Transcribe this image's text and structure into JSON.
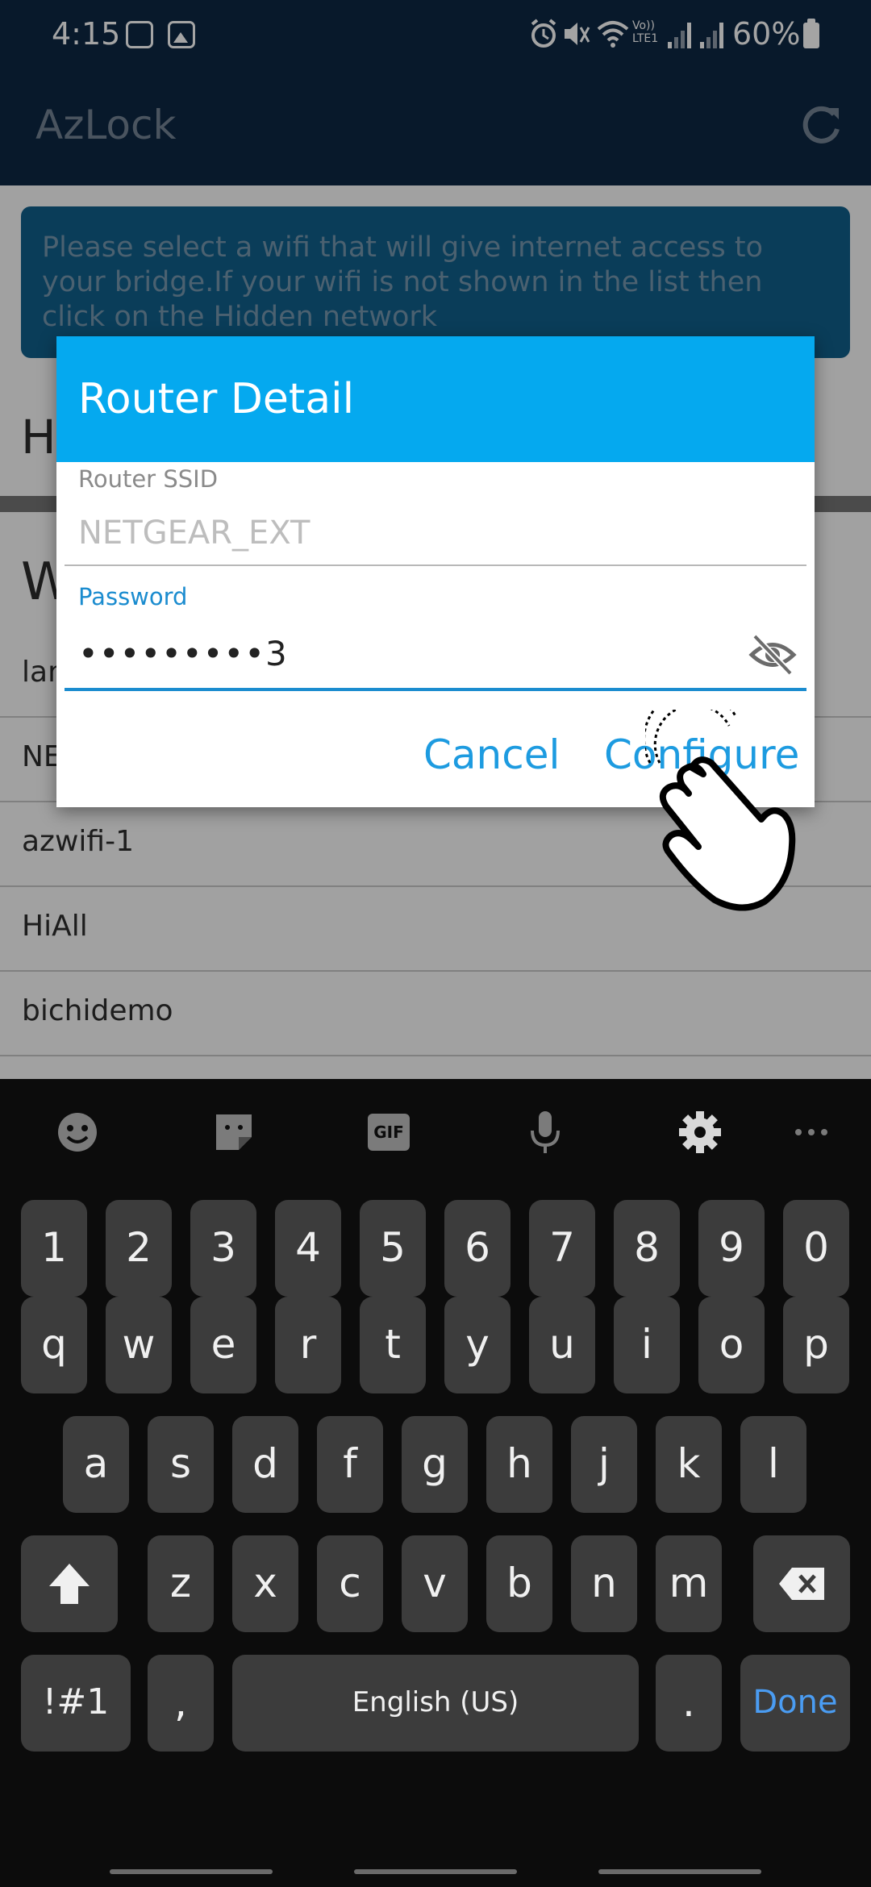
{
  "status_bar": {
    "time": "4:15",
    "battery": "60%",
    "icons": [
      "app-notification-icon",
      "gallery-icon",
      "alarm-icon",
      "mute-icon",
      "wifi-icon",
      "volte-icon",
      "signal-icon",
      "signal-icon",
      "battery-icon"
    ],
    "volte_label": "Vo)) LTE1"
  },
  "app_bar": {
    "title": "AzLock",
    "action_icon": "refresh-icon"
  },
  "background": {
    "banner_text": "Please select a wifi that will give internet access to your bridge.If your wifi is not shown in the list then click on the Hidden network",
    "section_h_letter": "H",
    "section_w_letter": "W",
    "wifi_list": [
      "lan",
      "NE",
      "azwifi-1",
      "HiAll",
      "bichidemo"
    ]
  },
  "dialog": {
    "title": "Router Detail",
    "ssid_label": "Router SSID",
    "ssid_value": "NETGEAR_EXT",
    "password_label": "Password",
    "password_value": "•••••••••3",
    "visibility_icon": "visibility-off-icon",
    "cancel_label": "Cancel",
    "configure_label": "Configure"
  },
  "keyboard": {
    "toolbar": [
      "emoji-icon",
      "sticker-icon",
      "gif-icon",
      "microphone-icon",
      "settings-icon",
      "more-icon"
    ],
    "gif_label": "GIF",
    "row_numbers": [
      "1",
      "2",
      "3",
      "4",
      "5",
      "6",
      "7",
      "8",
      "9",
      "0"
    ],
    "row_q": [
      "q",
      "w",
      "e",
      "r",
      "t",
      "y",
      "u",
      "i",
      "o",
      "p"
    ],
    "row_a": [
      "a",
      "s",
      "d",
      "f",
      "g",
      "h",
      "j",
      "k",
      "l"
    ],
    "row_z": [
      "z",
      "x",
      "c",
      "v",
      "b",
      "n",
      "m"
    ],
    "symbols_label": "!#1",
    "comma_label": ",",
    "space_label": "English (US)",
    "period_label": ".",
    "done_label": "Done"
  },
  "colors": {
    "app_bar": "#0c2540",
    "dialog_header": "#05a9ef",
    "accent": "#1d9be0",
    "keyboard_bg": "#0c0c0c",
    "key_bg": "#3c3c3c",
    "done_key_text": "#4a9cf2"
  }
}
